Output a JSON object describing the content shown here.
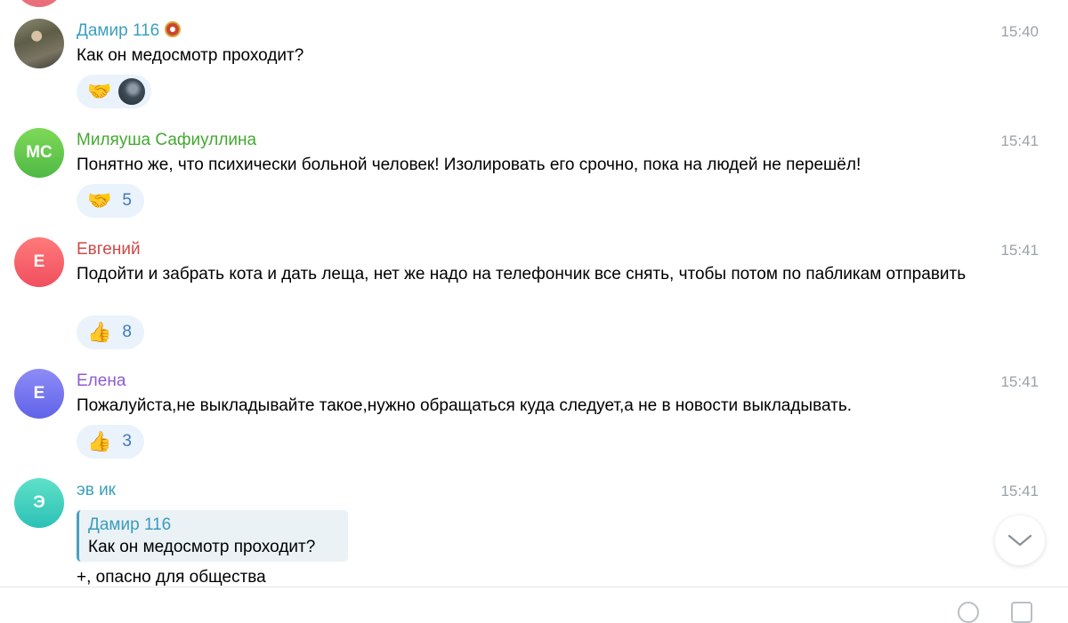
{
  "messages": [
    {
      "author": "Дамир 116",
      "author_color": "#3b9fbf",
      "time": "15:40",
      "text": "Как он медосмотр проходит?",
      "avatar": {
        "type": "photo"
      },
      "badge_icon": "verified-badge-icon",
      "reaction": {
        "emoji": "🤝",
        "icon": "handshake-icon",
        "count": null,
        "reactor_avatar": true
      }
    },
    {
      "author": "Миляуша Сафиуллина",
      "author_color": "#45a832",
      "time": "15:41",
      "text": "Понятно же, что психически больной человек! Изолировать его срочно, пока на людей не перешёл!",
      "avatar": {
        "type": "initials",
        "initials": "МС",
        "color_top": "#7ed957",
        "color_bottom": "#4fb946"
      },
      "reaction": {
        "emoji": "🤝",
        "icon": "handshake-icon",
        "count": "5"
      }
    },
    {
      "author": "Евгений",
      "author_color": "#cc4a4a",
      "time": "15:41",
      "text": "Подойти и забрать кота и дать леща, нет же надо на телефончик все снять, чтобы потом по пабликам отправить",
      "avatar": {
        "type": "initials",
        "initials": "Е",
        "color_top": "#ff7a7a",
        "color_bottom": "#f04f5f"
      },
      "reaction": {
        "emoji": "👍",
        "icon": "thumbs-up-icon",
        "count": "8"
      }
    },
    {
      "author": "Елена",
      "author_color": "#8e5bd0",
      "time": "15:41",
      "text": "Пожалуйста,не выкладывайте такое,нужно обращаться куда следует,а не в новости выкладывать.",
      "avatar": {
        "type": "initials",
        "initials": "Е",
        "color_top": "#8f8cf7",
        "color_bottom": "#5f63e8"
      },
      "reaction": {
        "emoji": "👍",
        "icon": "thumbs-up-icon",
        "count": "3"
      }
    },
    {
      "author": "эв ик",
      "author_color": "#3a9fbd",
      "time": "15:41",
      "text": "+, опасно для общества",
      "avatar": {
        "type": "initials",
        "initials": "Э",
        "color_top": "#5fe0c9",
        "color_bottom": "#2cc1b6"
      },
      "reply": {
        "author": "Дамир 116",
        "text": "Как он медосмотр проходит?"
      }
    }
  ],
  "scroll_down_button": {
    "icon": "chevron-down-icon"
  }
}
